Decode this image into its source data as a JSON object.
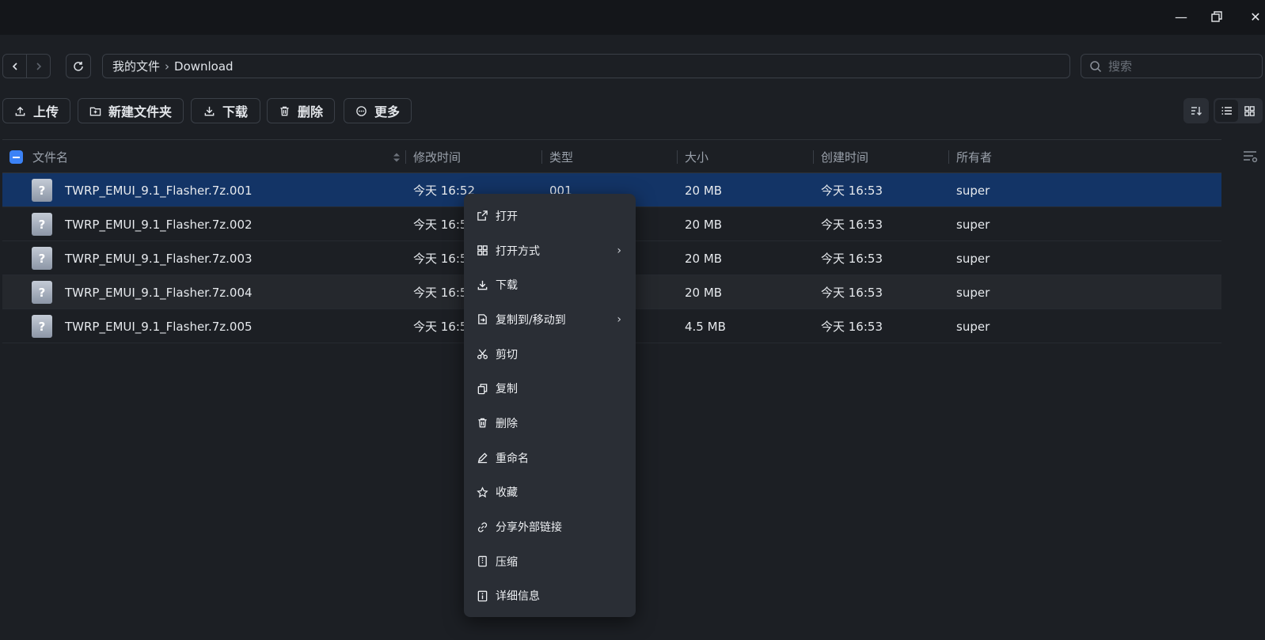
{
  "window": {
    "minimize_glyph": "—",
    "maximize_glyph": "❐",
    "close_glyph": "✕"
  },
  "nav": {
    "back_icon": "chevron-left-icon",
    "forward_icon": "chevron-right-icon",
    "refresh_icon": "refresh-icon"
  },
  "breadcrumb": {
    "root": "我的文件",
    "separator": "›",
    "current": "Download"
  },
  "search": {
    "placeholder": "搜索"
  },
  "toolbar": {
    "upload_label": "上传",
    "new_folder_label": "新建文件夹",
    "download_label": "下载",
    "delete_label": "删除",
    "more_label": "更多"
  },
  "table": {
    "columns": {
      "name": "文件名",
      "modified": "修改时间",
      "type": "类型",
      "size": "大小",
      "created": "创建时间",
      "owner": "所有者"
    },
    "rows": [
      {
        "icon": "?",
        "name": "TWRP_EMUI_9.1_Flasher.7z.001",
        "modified": "今天 16:52",
        "type": "001",
        "size": "20 MB",
        "created": "今天 16:53",
        "owner": "super"
      },
      {
        "icon": "?",
        "name": "TWRP_EMUI_9.1_Flasher.7z.002",
        "modified": "今天 16:5",
        "type": "",
        "size": "20 MB",
        "created": "今天 16:53",
        "owner": "super"
      },
      {
        "icon": "?",
        "name": "TWRP_EMUI_9.1_Flasher.7z.003",
        "modified": "今天 16:5",
        "type": "",
        "size": "20 MB",
        "created": "今天 16:53",
        "owner": "super"
      },
      {
        "icon": "?",
        "name": "TWRP_EMUI_9.1_Flasher.7z.004",
        "modified": "今天 16:5",
        "type": "",
        "size": "20 MB",
        "created": "今天 16:53",
        "owner": "super"
      },
      {
        "icon": "?",
        "name": "TWRP_EMUI_9.1_Flasher.7z.005",
        "modified": "今天 16:5",
        "type": "",
        "size": "4.5 MB",
        "created": "今天 16:53",
        "owner": "super"
      }
    ]
  },
  "context_menu": {
    "items": [
      {
        "label": "打开",
        "icon": "external-link-icon",
        "submenu": false
      },
      {
        "label": "打开方式",
        "icon": "grid-icon",
        "submenu": true
      },
      {
        "label": "下载",
        "icon": "download-icon",
        "submenu": false
      },
      {
        "label": "复制到/移动到",
        "icon": "move-to-icon",
        "submenu": true
      },
      {
        "label": "剪切",
        "icon": "scissors-icon",
        "submenu": false
      },
      {
        "label": "复制",
        "icon": "copy-icon",
        "submenu": false
      },
      {
        "label": "删除",
        "icon": "trash-icon",
        "submenu": false
      },
      {
        "label": "重命名",
        "icon": "pencil-icon",
        "submenu": false
      },
      {
        "label": "收藏",
        "icon": "star-icon",
        "submenu": false
      },
      {
        "label": "分享外部链接",
        "icon": "link-icon",
        "submenu": false
      },
      {
        "label": "压缩",
        "icon": "archive-icon",
        "submenu": false
      },
      {
        "label": "详细信息",
        "icon": "info-icon",
        "submenu": false
      }
    ],
    "submenu_arrow": "›"
  },
  "colors": {
    "background": "#1c1f24",
    "titlebar": "#14161a",
    "selected_row": "#133466",
    "menu_bg": "#2a2e35",
    "accent": "#3b82f6"
  }
}
